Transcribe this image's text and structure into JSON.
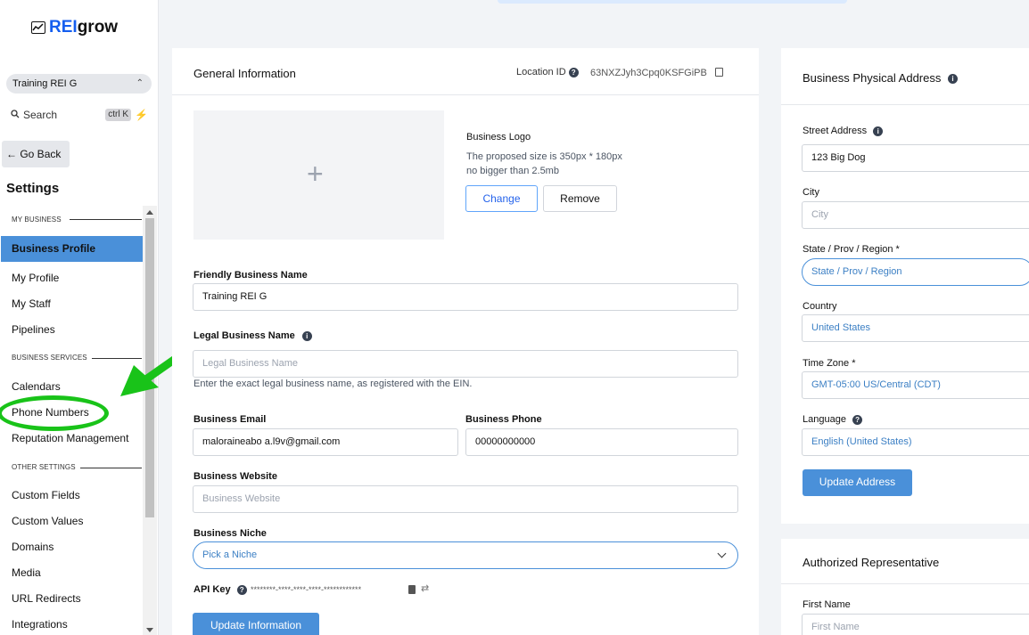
{
  "brand": {
    "part1": "REI",
    "part2": "grow"
  },
  "sidebar": {
    "account": "Training REI G",
    "search_label": "Search",
    "search_shortcut": "ctrl K",
    "go_back": "Go Back",
    "title": "Settings",
    "sections": {
      "my_business": "MY BUSINESS",
      "business_services": "BUSINESS SERVICES",
      "other_settings": "OTHER SETTINGS"
    },
    "items": {
      "business_profile": "Business Profile",
      "my_profile": "My Profile",
      "my_staff": "My Staff",
      "pipelines": "Pipelines",
      "calendars": "Calendars",
      "phone_numbers": "Phone Numbers",
      "reputation": "Reputation Management",
      "custom_fields": "Custom Fields",
      "custom_values": "Custom Values",
      "domains": "Domains",
      "media": "Media",
      "url_redirects": "URL Redirects",
      "integrations": "Integrations"
    }
  },
  "general": {
    "title": "General Information",
    "location_label": "Location ID",
    "location_id": "63NXZJyh3Cpq0KSFGiPB",
    "logo_title": "Business Logo",
    "logo_hint1": "The proposed size is 350px * 180px",
    "logo_hint2": "no bigger than 2.5mb",
    "change": "Change",
    "remove": "Remove",
    "friendly_label": "Friendly Business Name",
    "friendly_value": "Training REI G",
    "legal_label": "Legal Business Name",
    "legal_placeholder": "Legal Business Name",
    "legal_hint": "Enter the exact legal business name, as registered with the EIN.",
    "email_label": "Business Email",
    "email_value": "maloraineabo a.l9v@gmail.com",
    "phone_label": "Business Phone",
    "phone_value": "00000000000",
    "website_label": "Business Website",
    "website_placeholder": "Business Website",
    "niche_label": "Business Niche",
    "niche_value": "Pick a Niche",
    "api_label": "API Key",
    "api_value": "********-****-****-****-************",
    "update": "Update Information"
  },
  "address": {
    "title": "Business Physical Address",
    "street_label": "Street Address",
    "street_value": "123 Big Dog",
    "city_label": "City",
    "city_placeholder": "City",
    "state_label": "State / Prov / Region *",
    "state_value": "State / Prov / Region",
    "country_label": "Country",
    "country_value": "United States",
    "tz_label": "Time Zone *",
    "tz_value": "GMT-05:00 US/Central (CDT)",
    "lang_label": "Language",
    "lang_value": "English (United States)",
    "update": "Update Address"
  },
  "auth": {
    "title": "Authorized Representative",
    "first_label": "First Name",
    "first_placeholder": "First Name"
  },
  "colors": {
    "accent": "#4a90d9",
    "annotation": "#19c319"
  }
}
